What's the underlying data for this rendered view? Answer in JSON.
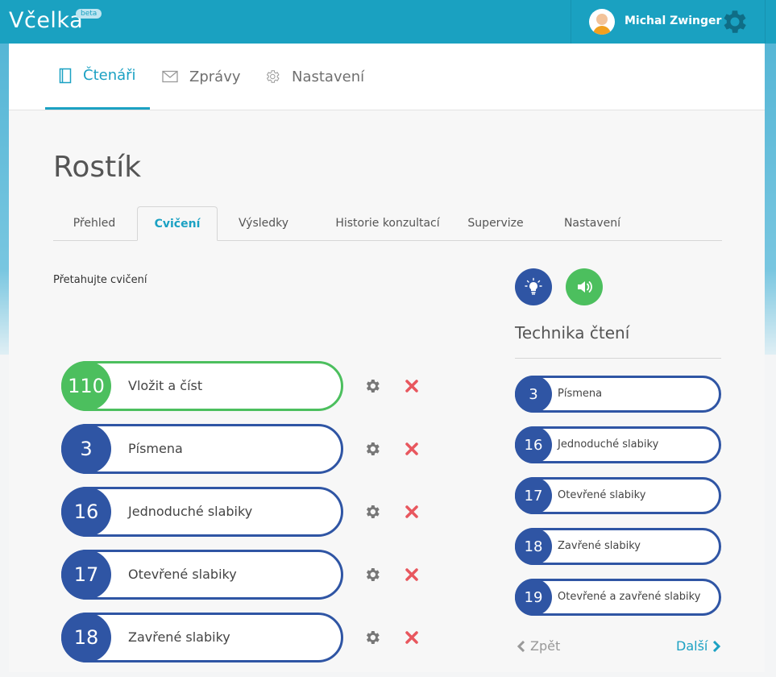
{
  "app": {
    "logo": "Včelka",
    "badge": "beta"
  },
  "user": {
    "name": "Michal Zwinger"
  },
  "main_nav": [
    {
      "label": "Čtenáři",
      "icon": "book-icon",
      "active": true
    },
    {
      "label": "Zprávy",
      "icon": "envelope-icon",
      "active": false
    },
    {
      "label": "Nastavení",
      "icon": "gear-icon",
      "active": false
    }
  ],
  "page": {
    "title": "Rostík"
  },
  "sub_tabs": [
    {
      "label": "Přehled",
      "active": false
    },
    {
      "label": "Cvičení",
      "active": true
    },
    {
      "label": "Výsledky",
      "active": false
    },
    {
      "label": "Historie konzultací",
      "active": false
    },
    {
      "label": "Supervize",
      "active": false
    },
    {
      "label": "Nastavení",
      "active": false
    }
  ],
  "hint": "Přetahujte cvičení",
  "exercises": [
    {
      "number": "110",
      "label": "Vložit a číst",
      "color": "#4cbf5e"
    },
    {
      "number": "3",
      "label": "Písmena",
      "color": "#2f55a4"
    },
    {
      "number": "16",
      "label": "Jednoduché slabiky",
      "color": "#2f55a4"
    },
    {
      "number": "17",
      "label": "Otevřené slabiky",
      "color": "#2f55a4"
    },
    {
      "number": "18",
      "label": "Zavřené slabiky",
      "color": "#2f55a4"
    }
  ],
  "right_panel": {
    "title": "Technika čtení",
    "items": [
      {
        "number": "3",
        "label": "Písmena"
      },
      {
        "number": "16",
        "label": "Jednoduché slabiky"
      },
      {
        "number": "17",
        "label": "Otevřené slabiky"
      },
      {
        "number": "18",
        "label": "Zavřené slabiky"
      },
      {
        "number": "19",
        "label": "Otevřené a zavřené slabiky"
      }
    ],
    "prev_label": "Zpět",
    "next_label": "Další"
  },
  "colors": {
    "accent": "#1ba1c3",
    "blue": "#2f55a4",
    "green": "#4cbf5e",
    "delete": "#e8575e"
  }
}
